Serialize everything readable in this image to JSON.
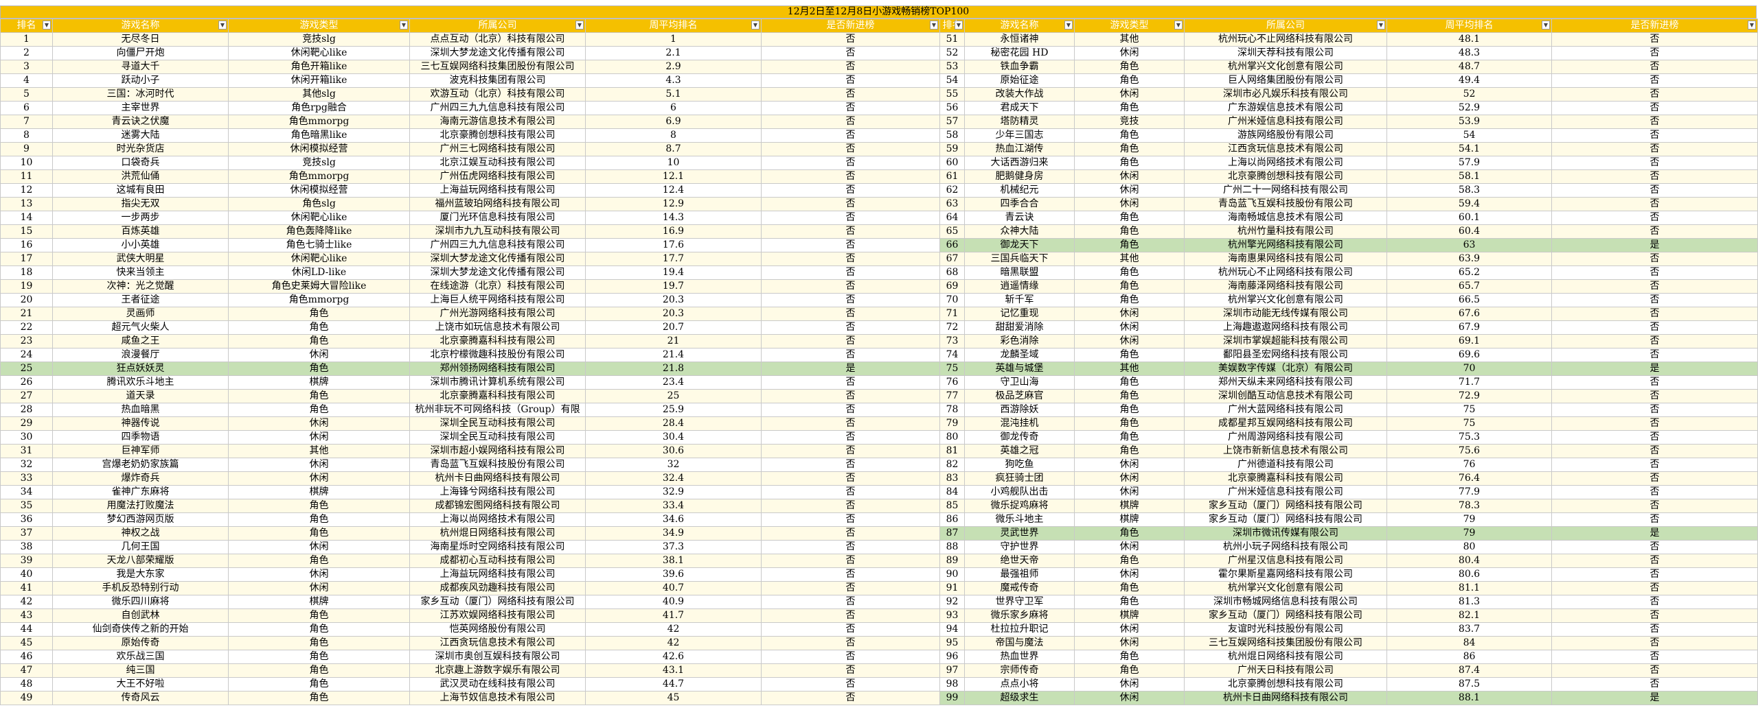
{
  "title": "12月2日至12月8日小游戏畅销榜TOP100",
  "headers": [
    "排名",
    "游戏名称",
    "游戏类型",
    "所属公司",
    "周平均排名",
    "是否新进榜"
  ],
  "filter_icon": "dropdown-arrow-icon",
  "colors": {
    "header_bg": "#f5c000",
    "header_text": "#ffffff",
    "row_odd": "#fffbe6",
    "row_even": "#ffffff",
    "row_new": "#c6e0b4",
    "grid_line": "#c9c9c9"
  },
  "left_rows": [
    [
      "1",
      "无尽冬日",
      "竞技slg",
      "点点互动（北京）科技有限公司",
      "1",
      "否"
    ],
    [
      "2",
      "向僵尸开炮",
      "休闲靶心like",
      "深圳大梦龙途文化传播有限公司",
      "2.1",
      "否"
    ],
    [
      "3",
      "寻道大千",
      "角色开箱like",
      "三七互娱网络科技集团股份有限公司",
      "2.9",
      "否"
    ],
    [
      "4",
      "跃动小子",
      "休闲开箱like",
      "波克科技集团有限公司",
      "4.3",
      "否"
    ],
    [
      "5",
      "三国：冰河时代",
      "其他slg",
      "欢游互动（北京）科技有限公司",
      "5.1",
      "否"
    ],
    [
      "6",
      "主宰世界",
      "角色rpg融合",
      "广州四三九九信息科技有限公司",
      "6",
      "否"
    ],
    [
      "7",
      "青云诀之伏魔",
      "角色mmorpg",
      "海南元游信息技术有限公司",
      "6.9",
      "否"
    ],
    [
      "8",
      "迷雾大陆",
      "角色暗黑like",
      "北京豪腾创想科技有限公司",
      "8",
      "否"
    ],
    [
      "9",
      "时光杂货店",
      "休闲模拟经营",
      "广州三七网络科技有限公司",
      "8.7",
      "否"
    ],
    [
      "10",
      "口袋奇兵",
      "竞技slg",
      "北京江娱互动科技有限公司",
      "10",
      "否"
    ],
    [
      "11",
      "洪荒仙俑",
      "角色mmorpg",
      "广州伍虎网络科技有限公司",
      "12.1",
      "否"
    ],
    [
      "12",
      "这城有良田",
      "休闲模拟经营",
      "上海益玩网络科技有限公司",
      "12.4",
      "否"
    ],
    [
      "13",
      "指尖无双",
      "角色slg",
      "福州蓝玻珀网络科技有限公司",
      "12.9",
      "否"
    ],
    [
      "14",
      "一步两步",
      "休闲靶心like",
      "厦门光环信息科技有限公司",
      "14.3",
      "否"
    ],
    [
      "15",
      "百炼英雄",
      "角色轰降降like",
      "深圳市九九互动科技有限公司",
      "16.9",
      "否"
    ],
    [
      "16",
      "小小英雄",
      "角色七骑士like",
      "广州四三九九信息科技有限公司",
      "17.6",
      "否"
    ],
    [
      "17",
      "武侠大明星",
      "休闲靶心like",
      "深圳大梦龙途文化传播有限公司",
      "17.7",
      "否"
    ],
    [
      "18",
      "快来当领主",
      "休闲LD-like",
      "深圳大梦龙途文化传播有限公司",
      "19.4",
      "否"
    ],
    [
      "19",
      "次神：光之觉醒",
      "角色史莱姆大冒险like",
      "在线途游（北京）科技有限公司",
      "19.7",
      "否"
    ],
    [
      "20",
      "王者征途",
      "角色mmorpg",
      "上海巨人统平网络科技有限公司",
      "20.3",
      "否"
    ],
    [
      "21",
      "灵画师",
      "角色",
      "广州光游网络科技有限公司",
      "20.3",
      "否"
    ],
    [
      "22",
      "超元气火柴人",
      "角色",
      "上饶市如玩信息技术有限公司",
      "20.7",
      "否"
    ],
    [
      "23",
      "咸鱼之王",
      "角色",
      "北京豪腾嘉科科技有限公司",
      "21",
      "否"
    ],
    [
      "24",
      "浪漫餐厅",
      "休闲",
      "北京柠檬微趣科技股份有限公司",
      "21.4",
      "否"
    ],
    [
      "25",
      "狂点妖妖灵",
      "角色",
      "郑州领扬网络科技有限公司",
      "21.8",
      "是"
    ],
    [
      "26",
      "腾讯欢乐斗地主",
      "棋牌",
      "深圳市腾讯计算机系统有限公司",
      "23.4",
      "否"
    ],
    [
      "27",
      "道天录",
      "角色",
      "北京豪腾嘉科科技有限公司",
      "25",
      "否"
    ],
    [
      "28",
      "热血暗黑",
      "角色",
      "杭州非玩不可网络科技（Group）有限",
      "25.9",
      "否"
    ],
    [
      "29",
      "神器传说",
      "休闲",
      "深圳全民互动科技有限公司",
      "28.4",
      "否"
    ],
    [
      "30",
      "四季物语",
      "休闲",
      "深圳全民互动科技有限公司",
      "30.4",
      "否"
    ],
    [
      "31",
      "巨神军师",
      "其他",
      "深圳市超小娱网络科技有限公司",
      "30.6",
      "否"
    ],
    [
      "32",
      "宫爆老奶奶家族篇",
      "休闲",
      "青岛蓝飞互娱科技股份有限公司",
      "32",
      "否"
    ],
    [
      "33",
      "爆炸奇兵",
      "休闲",
      "杭州卡日曲网络科技有限公司",
      "32.4",
      "否"
    ],
    [
      "34",
      "雀神广东麻将",
      "棋牌",
      "上海锋兮网络科技有限公司",
      "32.9",
      "否"
    ],
    [
      "35",
      "用魔法打败魔法",
      "角色",
      "成都锦宏图网络科技有限公司",
      "33.4",
      "否"
    ],
    [
      "36",
      "梦幻西游网页版",
      "角色",
      "上海以尚网络技术有限公司",
      "34.6",
      "否"
    ],
    [
      "37",
      "神权之战",
      "角色",
      "杭州焜日网络科技有限公司",
      "34.9",
      "否"
    ],
    [
      "38",
      "几何王国",
      "休闲",
      "海南星烁时空网络科技有限公司",
      "37.3",
      "否"
    ],
    [
      "39",
      "天龙八部荣耀版",
      "角色",
      "成都初心互动科技有限公司",
      "38.1",
      "否"
    ],
    [
      "40",
      "我是大东家",
      "休闲",
      "上海益玩网络科技有限公司",
      "39.6",
      "否"
    ],
    [
      "41",
      "手机反恐特别行动",
      "休闲",
      "成都疾风劲趣科技有限公司",
      "40.7",
      "否"
    ],
    [
      "42",
      "微乐四川麻将",
      "棋牌",
      "家乡互动（厦门）网络科技有限公司",
      "40.9",
      "否"
    ],
    [
      "43",
      "自创武林",
      "角色",
      "江苏欢娱网络科技有限公司",
      "41.7",
      "否"
    ],
    [
      "44",
      "仙剑奇侠传之新的开始",
      "角色",
      "恺英网络股份有限公司",
      "42",
      "否"
    ],
    [
      "45",
      "原始传奇",
      "角色",
      "江西贪玩信息技术有限公司",
      "42",
      "否"
    ],
    [
      "46",
      "欢乐战三国",
      "角色",
      "深圳市奥创互娱科技有限公司",
      "42.6",
      "否"
    ],
    [
      "47",
      "纯三国",
      "角色",
      "北京趣上游数字娱乐有限公司",
      "43.1",
      "否"
    ],
    [
      "48",
      "大王不好啦",
      "角色",
      "武汉灵动在线科技有限公司",
      "44.7",
      "否"
    ],
    [
      "49",
      "传奇风云",
      "角色",
      "上海节奴信息技术有限公司",
      "45",
      "否"
    ]
  ],
  "right_rows": [
    [
      "51",
      "永恒诸神",
      "其他",
      "杭州玩心不止网络科技有限公司",
      "48.1",
      "否"
    ],
    [
      "52",
      "秘密花园 HD",
      "休闲",
      "深圳天荐科技有限公司",
      "48.3",
      "否"
    ],
    [
      "53",
      "铁血争霸",
      "角色",
      "杭州掌兴文化创意有限公司",
      "48.7",
      "否"
    ],
    [
      "54",
      "原始征途",
      "角色",
      "巨人网络集团股份有限公司",
      "49.4",
      "否"
    ],
    [
      "55",
      "改装大作战",
      "休闲",
      "深圳市必凡娱乐科技有限公司",
      "52",
      "否"
    ],
    [
      "56",
      "君成天下",
      "角色",
      "广东游娱信息技术有限公司",
      "52.9",
      "否"
    ],
    [
      "57",
      "塔防精灵",
      "竞技",
      "广州米娅信息科技有限公司",
      "53.9",
      "否"
    ],
    [
      "58",
      "少年三国志",
      "角色",
      "游族网络股份有限公司",
      "54",
      "否"
    ],
    [
      "59",
      "热血江湖传",
      "角色",
      "江西贪玩信息技术有限公司",
      "54.1",
      "否"
    ],
    [
      "60",
      "大话西游归来",
      "角色",
      "上海以尚网络技术有限公司",
      "57.9",
      "否"
    ],
    [
      "61",
      "肥鹅健身房",
      "休闲",
      "北京豪腾创想科技有限公司",
      "58.1",
      "否"
    ],
    [
      "62",
      "机械纪元",
      "休闲",
      "广州二十一网络科技有限公司",
      "58.3",
      "否"
    ],
    [
      "63",
      "四季合合",
      "休闲",
      "青岛蓝飞互娱科技股份有限公司",
      "59.4",
      "否"
    ],
    [
      "64",
      "青云诀",
      "角色",
      "海南畅城信息技术有限公司",
      "60.1",
      "否"
    ],
    [
      "65",
      "众神大陆",
      "角色",
      "杭州竹量科技有限公司",
      "60.4",
      "否"
    ],
    [
      "66",
      "御龙天下",
      "角色",
      "杭州擎光网络科技有限公司",
      "63",
      "是"
    ],
    [
      "67",
      "三国兵临天下",
      "其他",
      "海南惠果网络科技有限公司",
      "63.9",
      "否"
    ],
    [
      "68",
      "暗黑联盟",
      "角色",
      "杭州玩心不止网络科技有限公司",
      "65.2",
      "否"
    ],
    [
      "69",
      "逍遥情缘",
      "角色",
      "海南藤泽网络科技有限公司",
      "65.7",
      "否"
    ],
    [
      "70",
      "斩千军",
      "角色",
      "杭州掌兴文化创意有限公司",
      "66.5",
      "否"
    ],
    [
      "71",
      "记忆重现",
      "休闲",
      "深圳市动能无线传媒有限公司",
      "67.6",
      "否"
    ],
    [
      "72",
      "甜甜爱消除",
      "休闲",
      "上海趣遨遨网络科技有限公司",
      "67.9",
      "否"
    ],
    [
      "73",
      "彩色消除",
      "休闲",
      "深圳市掌娱超能科技有限公司",
      "69.1",
      "否"
    ],
    [
      "74",
      "龙麟圣域",
      "角色",
      "鄱阳县圣宏网络科技有限公司",
      "69.6",
      "否"
    ],
    [
      "75",
      "英雄与城堡",
      "其他",
      "美娱数字传媒（北京）有限公司",
      "70",
      "是"
    ],
    [
      "76",
      "守卫山海",
      "角色",
      "郑州天纵未来网络科技有限公司",
      "71.7",
      "否"
    ],
    [
      "77",
      "极品芝麻官",
      "角色",
      "深圳创酷互动信息技术有限公司",
      "72.9",
      "否"
    ],
    [
      "78",
      "西游除妖",
      "角色",
      "广州大蓝网络科技有限公司",
      "75",
      "否"
    ],
    [
      "79",
      "混沌挂机",
      "角色",
      "成都星邦互娱网络科技有限公司",
      "75",
      "否"
    ],
    [
      "80",
      "御龙传奇",
      "角色",
      "广州周游网络科技有限公司",
      "75.3",
      "否"
    ],
    [
      "81",
      "英雄之冠",
      "角色",
      "上饶市新新信息技术有限公司",
      "75.6",
      "否"
    ],
    [
      "82",
      "狗吃鱼",
      "休闲",
      "广州德道科技有限公司",
      "76",
      "否"
    ],
    [
      "83",
      "疯狂骑士团",
      "休闲",
      "北京豪腾嘉科科技有限公司",
      "76.4",
      "否"
    ],
    [
      "84",
      "小鸡舰队出击",
      "休闲",
      "广州米娅信息科技有限公司",
      "77.9",
      "否"
    ],
    [
      "85",
      "微乐捉鸡麻将",
      "棋牌",
      "家乡互动（厦门）网络科技有限公司",
      "78.3",
      "否"
    ],
    [
      "86",
      "微乐斗地主",
      "棋牌",
      "家乡互动（厦门）网络科技有限公司",
      "79",
      "否"
    ],
    [
      "87",
      "灵武世界",
      "角色",
      "深圳市微讯传媒有限公司",
      "79",
      "是"
    ],
    [
      "88",
      "守护世界",
      "休闲",
      "杭州小玩子网络科技有限公司",
      "80",
      "否"
    ],
    [
      "89",
      "绝世天帝",
      "角色",
      "广州星汉信息科技有限公司",
      "80.4",
      "否"
    ],
    [
      "90",
      "最强祖师",
      "休闲",
      "霍尔果斯星嘉网络科技有限公司",
      "80.6",
      "否"
    ],
    [
      "91",
      "魔戒传奇",
      "角色",
      "杭州掌兴文化创意有限公司",
      "81.1",
      "否"
    ],
    [
      "92",
      "世界守卫军",
      "角色",
      "深圳市畅城网络信息科技有限公司",
      "81.3",
      "否"
    ],
    [
      "93",
      "微乐家乡麻将",
      "棋牌",
      "家乡互动（厦门）网络科技有限公司",
      "82.1",
      "否"
    ],
    [
      "94",
      "杜拉拉升职记",
      "休闲",
      "友谊时光科技股份有限公司",
      "83.7",
      "否"
    ],
    [
      "95",
      "帝国与魔法",
      "休闲",
      "三七互娱网络科技集团股份有限公司",
      "84",
      "否"
    ],
    [
      "96",
      "热血世界",
      "角色",
      "杭州焜日网络科技有限公司",
      "86",
      "否"
    ],
    [
      "97",
      "宗师传奇",
      "角色",
      "广州天日科技有限公司",
      "87.4",
      "否"
    ],
    [
      "98",
      "点点小将",
      "休闲",
      "北京豪腾创想科技有限公司",
      "87.5",
      "否"
    ],
    [
      "99",
      "超级求生",
      "休闲",
      "杭州卡日曲网络科技有限公司",
      "88.1",
      "是"
    ]
  ]
}
